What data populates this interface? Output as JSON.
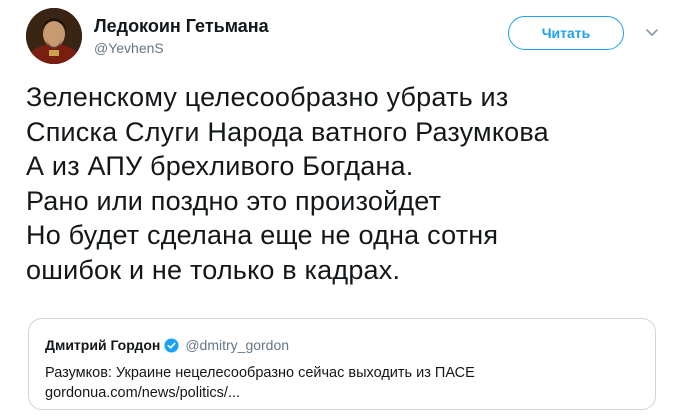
{
  "author": {
    "display_name": "Ледокоин Гетьмана",
    "handle": "@YevhenS"
  },
  "follow_label": "Читать",
  "tweet_text": "Зеленскому целесообразно убрать из\nСписка Слуги Народа ватного Разумкова\nА из АПУ брехливого Богдана.\nРано или поздно это произойдет\nНо будет сделана еще не одна сотня\nошибок и не только в кадрах.",
  "quote": {
    "name": "Дмитрий Гордон",
    "handle": "@dmitry_gordon",
    "text": "Разумков: Украине нецелесообразно сейчас выходить из ПАСЕ",
    "link": "gordonua.com/news/politics/..."
  },
  "icons": {
    "caret": "chevron-down-icon",
    "verified": "verified-badge-icon"
  },
  "colors": {
    "accent": "#1da1f2",
    "text": "#14171a",
    "secondary": "#657786",
    "border": "#ccd6dd"
  }
}
